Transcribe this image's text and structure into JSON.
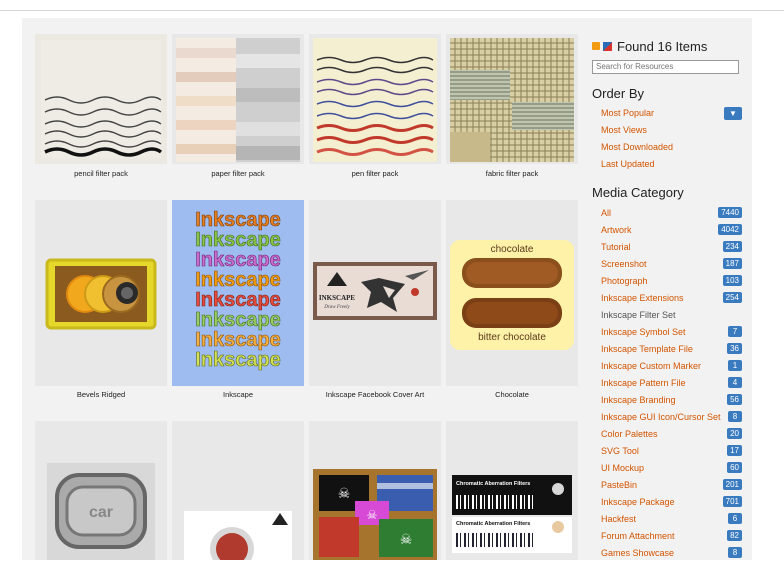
{
  "items": [
    {
      "caption": "pencil filter pack"
    },
    {
      "caption": "paper filter pack"
    },
    {
      "caption": "pen filter pack"
    },
    {
      "caption": "fabric filter pack"
    },
    {
      "caption": "Bevels Ridged"
    },
    {
      "caption": "Inkscape"
    },
    {
      "caption": "Inkscape Facebook Cover Art"
    },
    {
      "caption": "Chocolate"
    }
  ],
  "thumb_text": {
    "inkscape_word": "Inkscape",
    "chocolate_top": "chocolate",
    "chocolate_bottom": "bitter chocolate",
    "cover_brand": "INKSCAPE",
    "cover_sub": "Draw Freely",
    "chroma_title": "Chromatic Aberration Filters",
    "logo_text": "car"
  },
  "sidebar": {
    "found": "Found 16 Items",
    "search_placeholder": "Search for Resources",
    "order_title": "Order By",
    "order_items": [
      "Most Popular",
      "Most Views",
      "Most Downloaded",
      "Last Updated"
    ],
    "category_title": "Media Category",
    "categories": [
      {
        "label": "All",
        "count": "7440"
      },
      {
        "label": "Artwork",
        "count": "4042"
      },
      {
        "label": "Tutorial",
        "count": "234"
      },
      {
        "label": "Screenshot",
        "count": "187"
      },
      {
        "label": "Photograph",
        "count": "103"
      },
      {
        "label": "Inkscape Extensions",
        "count": "254"
      },
      {
        "label": "Inkscape Filter Set",
        "count": ""
      },
      {
        "label": "Inkscape Symbol Set",
        "count": "7"
      },
      {
        "label": "Inkscape Template File",
        "count": "36"
      },
      {
        "label": "Inkscape Custom Marker",
        "count": "1"
      },
      {
        "label": "Inkscape Pattern File",
        "count": "4"
      },
      {
        "label": "Inkscape Branding",
        "count": "56"
      },
      {
        "label": "Inkscape GUI Icon/Cursor Set",
        "count": "8"
      },
      {
        "label": "Color Palettes",
        "count": "20"
      },
      {
        "label": "SVG Tool",
        "count": "17"
      },
      {
        "label": "UI Mockup",
        "count": "60"
      },
      {
        "label": "PasteBin",
        "count": "201"
      },
      {
        "label": "Inkscape Package",
        "count": "701"
      },
      {
        "label": "Hackfest",
        "count": "6"
      },
      {
        "label": "Forum Attachment",
        "count": "82"
      },
      {
        "label": "Games Showcase",
        "count": "8"
      }
    ]
  }
}
